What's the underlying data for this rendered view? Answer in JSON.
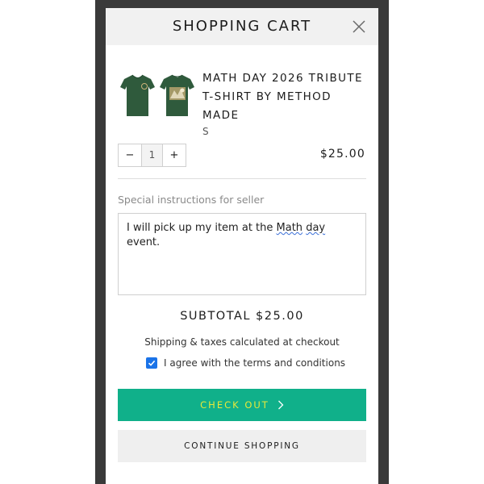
{
  "cart": {
    "title": "SHOPPING CART",
    "close_icon": "close-icon"
  },
  "item": {
    "name": "MATH DAY 2026 TRIBUTE T-SHIRT BY METHOD MADE",
    "variant": "S",
    "quantity": "1",
    "decrement_label": "−",
    "increment_label": "+",
    "price": "$25.00",
    "image_icon": "t-shirt-front-back-image"
  },
  "instructions": {
    "label": "Special instructions for seller",
    "text_before": "I will pick up my item at the ",
    "text_flagged_1": "Math",
    "text_space": " ",
    "text_flagged_2": "day",
    "text_after": " event."
  },
  "summary": {
    "subtotal": "SUBTOTAL $25.00",
    "shipping_note": "Shipping & taxes calculated at checkout",
    "terms_label": "I agree with the terms and conditions",
    "terms_checked": true
  },
  "actions": {
    "checkout_label": "CHECK OUT",
    "continue_label": "CONTINUE SHOPPING"
  },
  "colors": {
    "checkout_bg": "#10b08a",
    "checkout_text": "#e6e93a",
    "checkbox": "#1a73e8",
    "shirt": "#2f5a3c"
  }
}
